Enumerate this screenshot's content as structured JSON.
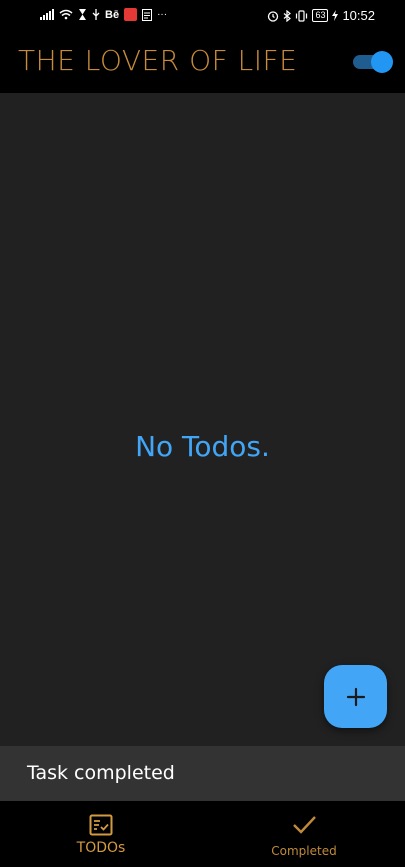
{
  "status_bar": {
    "time": "10:52",
    "battery": "63",
    "notif_text": "Bē",
    "more": "···"
  },
  "app_bar": {
    "title": "THE LOVER OF LIFE",
    "theme_toggle_on": true,
    "title_color": "#c88b3a",
    "toggle_color": "#2196f3"
  },
  "main": {
    "empty_message": "No Todos.",
    "empty_color": "#42a5f5"
  },
  "fab": {
    "icon": "plus-icon",
    "color": "#42a5f5"
  },
  "snackbar": {
    "message": "Task completed"
  },
  "bottom_nav": {
    "items": [
      {
        "label": "TODOs",
        "icon": "checklist-icon",
        "selected": true
      },
      {
        "label": "Completed",
        "icon": "check-icon",
        "selected": false
      }
    ],
    "accent": "#d49a3f"
  }
}
